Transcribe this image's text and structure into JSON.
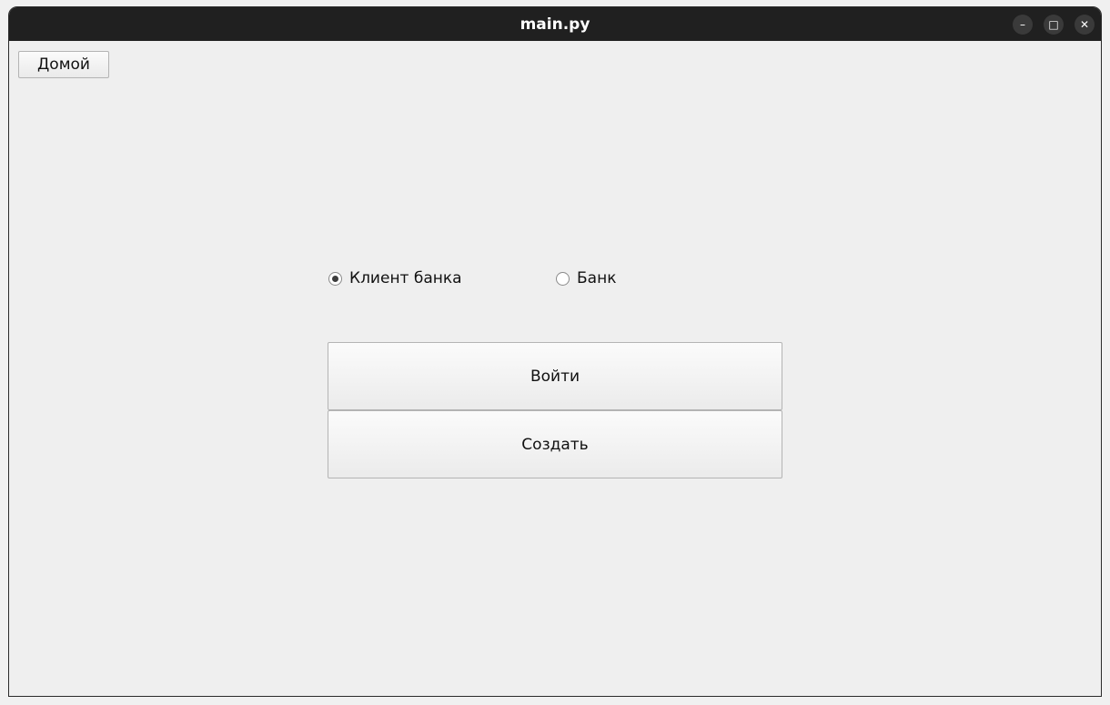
{
  "window": {
    "title": "main.py",
    "controls": {
      "minimize": "–",
      "maximize": "□",
      "close": "✕"
    }
  },
  "toolbar": {
    "home_label": "Домой"
  },
  "role_select": {
    "options": [
      {
        "label": "Клиент банка",
        "checked": true
      },
      {
        "label": "Банк",
        "checked": false
      }
    ]
  },
  "actions": {
    "login_label": "Войти",
    "create_label": "Создать"
  }
}
